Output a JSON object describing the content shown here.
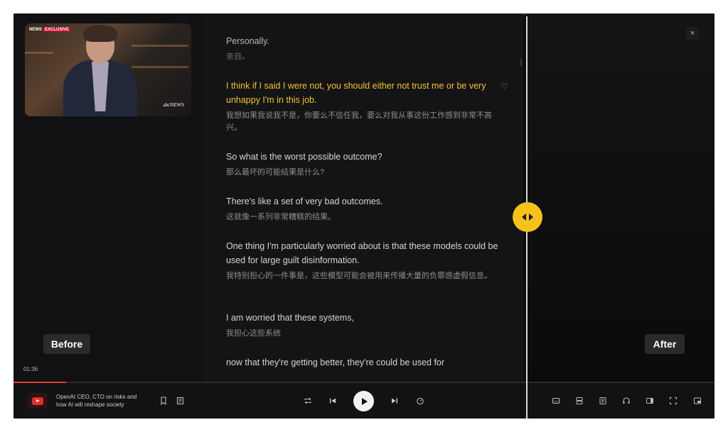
{
  "video": {
    "badge_network": "NEWS",
    "badge_exclusive": "EXCLUSIVE",
    "bug": "abcNEWS",
    "timecode": "01:36",
    "title": "OpenAI CEO, CTO on risks and how AI will reshape society",
    "progress_percent": 7.5
  },
  "compare": {
    "before_label": "Before",
    "after_label": "After"
  },
  "transcript": [
    {
      "en": "Personally.",
      "zh": "亲自。"
    },
    {
      "en": "I think if I said I were not, you should either not trust me or be very unhappy I'm in this job.",
      "zh": "我想如果我说我不是，你要么不信任我，要么对我从事这份工作感到非常不高兴。",
      "highlighted": true
    },
    {
      "en": "So what is the worst possible outcome?",
      "zh": "那么最坏的可能结果是什么?"
    },
    {
      "en": "There's like a set of very bad outcomes.",
      "zh": "这就像一系列非常糟糕的结果。"
    },
    {
      "en": "One thing I'm particularly worried about is that these models could be used for large guilt disinformation.",
      "zh": "我特别担心的一件事是，这些模型可能会被用来传播大量的负罪感虚假信息。"
    },
    {
      "en": "I am worried that these systems,",
      "zh": "我担心这些系统"
    },
    {
      "en": "now that they're getting better, they're could be used for",
      "zh": ""
    }
  ],
  "colors": {
    "highlight": "#f0c232",
    "handle": "#f4c21b",
    "progress": "#e53935"
  },
  "icons": {
    "close": "close-icon",
    "favorite": "heart-icon",
    "compare_handle": "split-arrows-icon"
  },
  "controls": {
    "close_glyph": "×",
    "heart_glyph": "♡"
  }
}
